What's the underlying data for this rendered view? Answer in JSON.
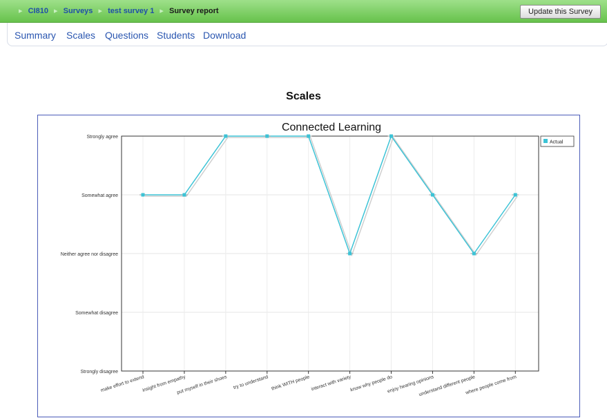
{
  "breadcrumb": {
    "items": [
      "CI810",
      "Surveys",
      "test survey 1"
    ],
    "current": "Survey report"
  },
  "update_button": "Update this Survey",
  "tabs": [
    "Summary",
    "Scales",
    "Questions",
    "Students",
    "Download"
  ],
  "section_title": "Scales",
  "colors": {
    "series": "#3cc3d6",
    "navbar": "#67c24c",
    "frame": "#4a5bb8"
  },
  "chart_data": {
    "type": "line",
    "title": "Connected Learning",
    "categories": [
      "make effort to extend",
      "insight from empathy",
      "put myself in their shoes",
      "try to understand",
      "think WITH people",
      "interact with variety",
      "know why people do",
      "enjoy hearing opinions",
      "understand different people",
      "where people come from"
    ],
    "y_levels": [
      "Strongly disagree",
      "Somewhat disagree",
      "Neither agree nor disagree",
      "Somewhat agree",
      "Strongly agree"
    ],
    "ylim": [
      1,
      5
    ],
    "series": [
      {
        "name": "Actual",
        "values": [
          4,
          4,
          5,
          5,
          5,
          3,
          5,
          4,
          3,
          4
        ]
      }
    ],
    "legend": "top-right",
    "grid": true
  }
}
